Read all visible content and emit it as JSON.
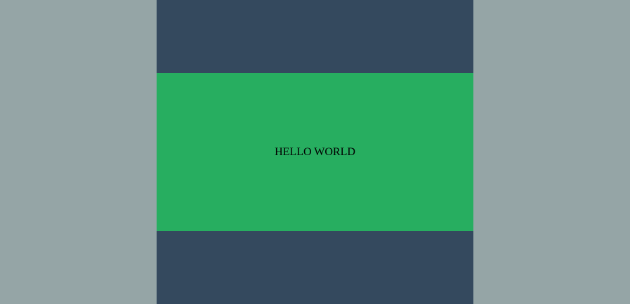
{
  "main": {
    "text": "HELLO WORLD"
  },
  "colors": {
    "page_background": "#95a5a6",
    "top_band": "#34495e",
    "middle_band": "#27ae60",
    "bottom_band": "#34495e",
    "text": "#000000"
  }
}
